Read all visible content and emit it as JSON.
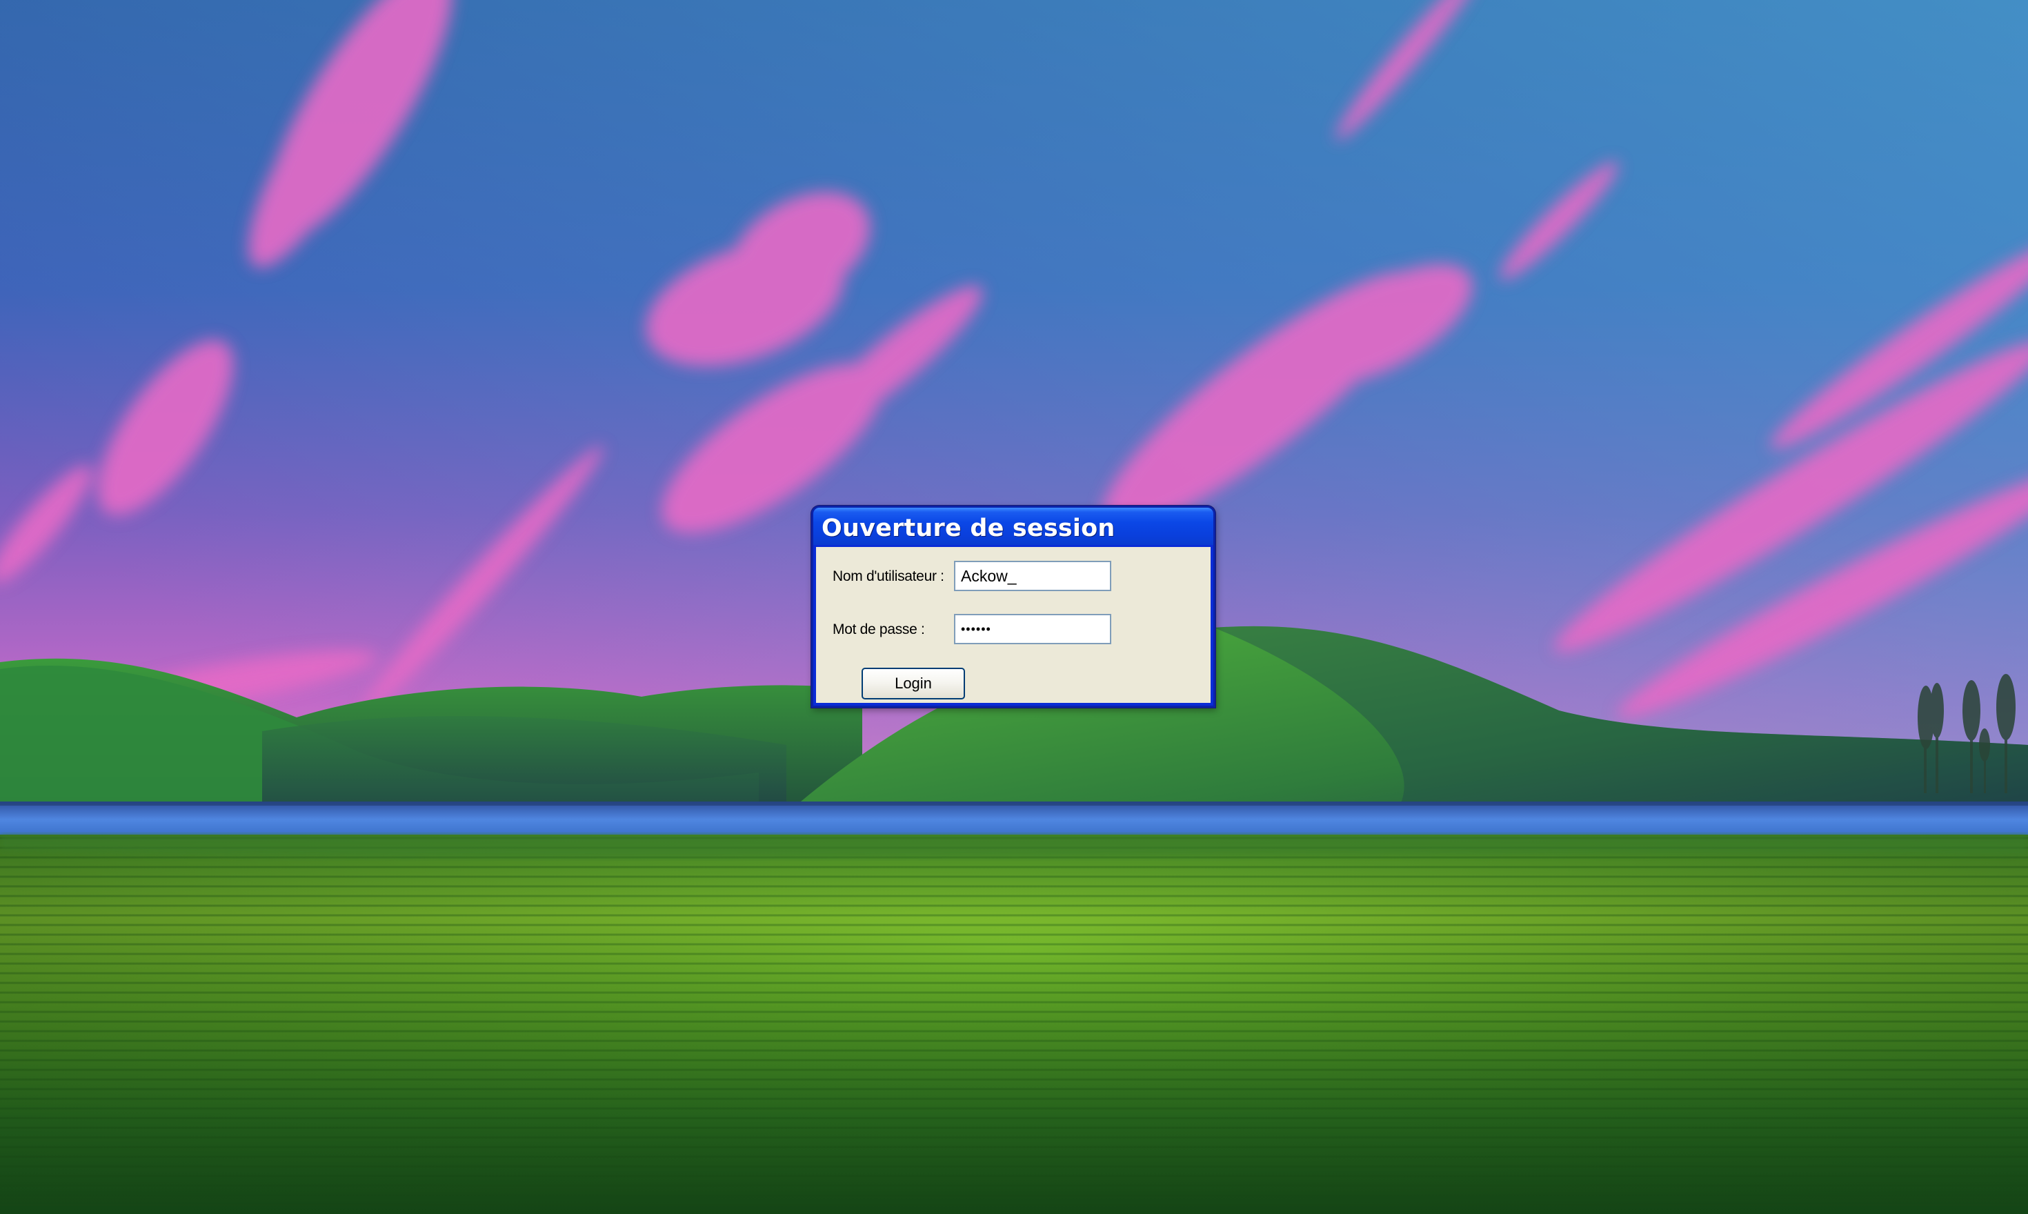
{
  "desktop": {
    "wallpaper": "bliss-style hills with pink clouds"
  },
  "login_window": {
    "title": "Ouverture de session",
    "username_label": "Nom d'utilisateur :",
    "username_value": "Ackow_",
    "password_label": "Mot de passe :",
    "password_value": "••••••",
    "login_button": "Login"
  },
  "colors": {
    "titlebar": "#0a47e0",
    "window_border": "#0b22a8",
    "client_background": "#ece9d8",
    "button_border": "#003c74"
  }
}
